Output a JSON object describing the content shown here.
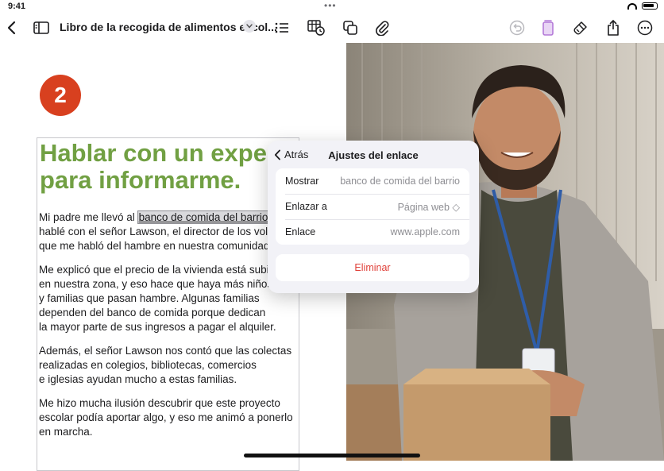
{
  "status_bar": {
    "time": "9:41",
    "dots": "•••"
  },
  "toolbar": {
    "document_title": "Libro de la recogida de alimentos escol...",
    "icons": [
      "back-icon",
      "sidebar-icon",
      "chevron-down-icon",
      "list-icon",
      "table-clock-icon",
      "layers-icon",
      "paperclip-icon",
      "undo-icon",
      "document-icon",
      "brush-icon",
      "share-icon",
      "more-icon"
    ]
  },
  "page": {
    "badge_number": "2",
    "heading_line1": "Hablar con un expert",
    "heading_line2": "para informarme.",
    "paragraph1": {
      "line1_before_link": "Mi padre me llevó al ",
      "link_text": "banco de comida del barrio",
      "line2": "hablé con el señor Lawson, el director de los volun",
      "line3": "que me habló del hambre en nuestra comunidad."
    },
    "paragraph2": [
      "Me explicó que el precio de la vivienda está subi",
      "en nuestra zona, y eso hace que haya más niños",
      "y familias que pasan hambre. Algunas familias",
      "dependen del banco de comida porque dedican",
      "la mayor parte de sus ingresos a pagar el alquiler."
    ],
    "paragraph3": [
      "Además, el señor Lawson nos contó que las colectas",
      "realizadas en colegios, bibliotecas, comercios",
      "e iglesias ayudan mucho a estas familias."
    ],
    "paragraph4": [
      "Me hizo mucha ilusión descubrir que este proyecto",
      "escolar podía aportar algo, y eso me animó a ponerlo",
      "en marcha."
    ]
  },
  "popover": {
    "back_label": "Atrás",
    "title": "Ajustes del enlace",
    "rows": [
      {
        "label": "Mostrar",
        "value": "banco de comida del barrio"
      },
      {
        "label": "Enlazar a",
        "value": "Página web ◇"
      },
      {
        "label": "Enlace",
        "value": "www.apple.com"
      }
    ],
    "delete_label": "Eliminar"
  },
  "colors": {
    "accent_green": "#71a043",
    "badge_orange": "#d8401f",
    "delete_red": "#e0413a",
    "toolbar_purple": "#b47ad8"
  }
}
